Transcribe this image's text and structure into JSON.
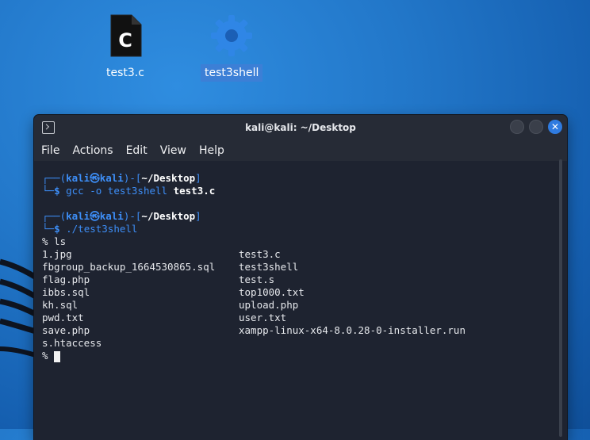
{
  "desktop": {
    "icons": [
      {
        "label": "test3.c",
        "glyph": "C"
      },
      {
        "label": "test3shell"
      }
    ]
  },
  "window": {
    "title": "kali@kali: ~/Desktop",
    "close_glyph": "✕",
    "menu": [
      "File",
      "Actions",
      "Edit",
      "View",
      "Help"
    ]
  },
  "terminal": {
    "prompt1": {
      "top_prefix": "┌──(",
      "user": "kali",
      "at": "㉿",
      "host": "kali",
      "mid": ")-[",
      "path": "~/Desktop",
      "end": "]",
      "bottom_prefix": "└─",
      "dollar": "$ ",
      "cmd": "gcc -o test3shell ",
      "cmd_bold": "test3.c"
    },
    "prompt2": {
      "top_prefix": "┌──(",
      "user": "kali",
      "at": "㉿",
      "host": "kali",
      "mid": ")-[",
      "path": "~/Desktop",
      "end": "]",
      "bottom_prefix": "└─",
      "dollar": "$ ",
      "cmd": "./test3shell"
    },
    "shell_cmd": "% ls",
    "ls_left": [
      "1.jpg",
      "fbgroup_backup_1664530865.sql",
      "flag.php",
      "ibbs.sql",
      "kh.sql",
      "pwd.txt",
      "save.php",
      "s.htaccess"
    ],
    "ls_right": [
      "test3.c",
      "test3shell",
      "test.s",
      "top1000.txt",
      "upload.php",
      "user.txt",
      "xampp-linux-x64-8.0.28-0-installer.run",
      ""
    ],
    "final_prompt": "% "
  },
  "colors": {
    "accent": "#3d8ef7",
    "terminal_bg": "#1e2330",
    "desktop": "#2277c9"
  }
}
